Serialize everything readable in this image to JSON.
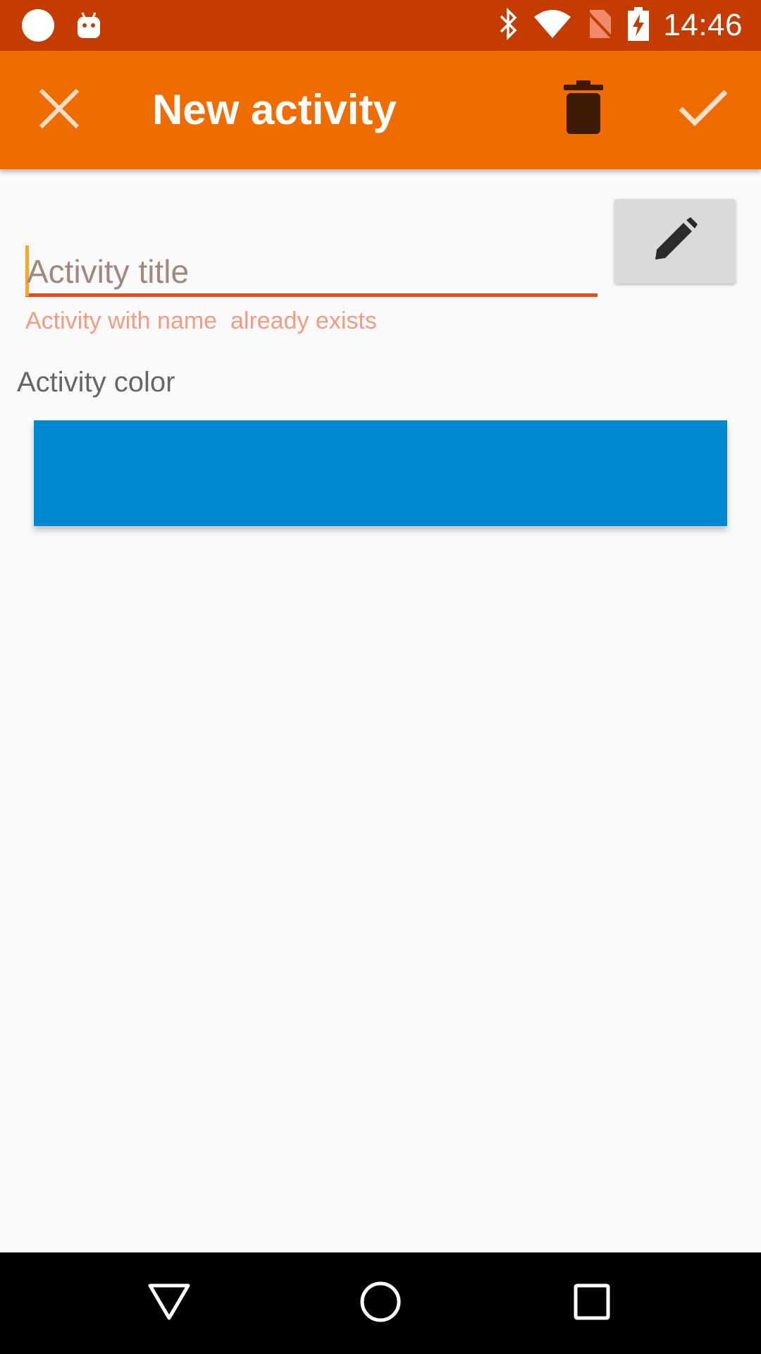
{
  "status_bar": {
    "time": "14:46",
    "icons": [
      "circle-notification-icon",
      "android-icon",
      "bluetooth-icon",
      "wifi-icon",
      "no-sim-icon",
      "battery-charging-icon"
    ]
  },
  "app_bar": {
    "title": "New activity",
    "close_icon": "close-icon",
    "delete_icon": "trash-icon",
    "save_icon": "check-icon",
    "color": "#EF6C00"
  },
  "form": {
    "title_value": "",
    "title_placeholder": "Activity title",
    "error": "Activity with name  already exists",
    "edit_icon": "pencil-icon",
    "color_label": "Activity color",
    "selected_color": "#0288D1"
  },
  "nav_bar": {
    "icons": [
      "back-icon",
      "home-icon",
      "recents-icon"
    ]
  }
}
